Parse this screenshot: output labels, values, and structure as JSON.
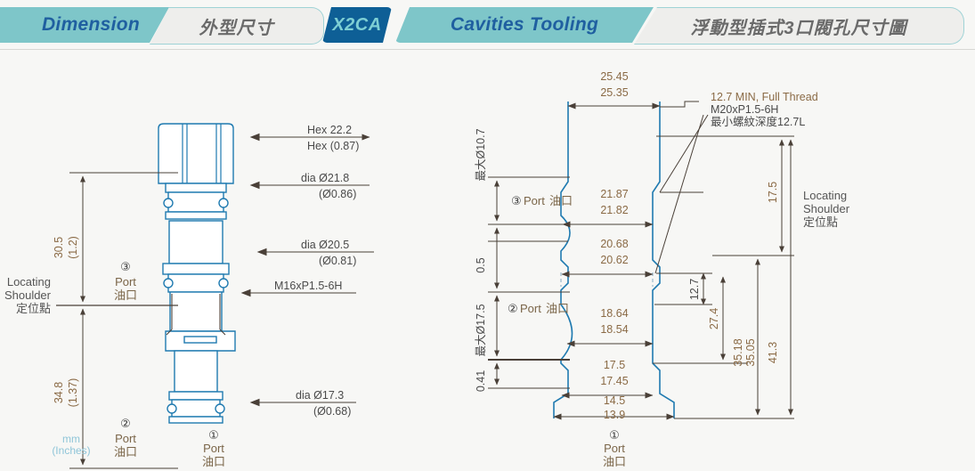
{
  "header": {
    "tabs": [
      {
        "id": "dimension",
        "label": "Dimension",
        "type": "en"
      },
      {
        "id": "dimension-zh",
        "label": "外型尺寸",
        "type": "zh"
      },
      {
        "id": "x2ca",
        "label": "X2CA",
        "type": "code"
      },
      {
        "id": "cavities-tooling",
        "label": "Cavities Tooling",
        "type": "en"
      },
      {
        "id": "cavities-tooling-zh",
        "label": "浮動型插式3口閥孔尺寸圖",
        "type": "zh"
      }
    ],
    "colors": {
      "teal": "#7ec6c9",
      "dark_blue": "#0e5f96",
      "light_gray": "#eeeeec",
      "text_blue": "#1f5fa0",
      "badge_text": "#7ecfd4"
    }
  },
  "left_drawing": {
    "title_unit_mm": "mm",
    "title_unit_in": "(Inches)",
    "vertical_dims": [
      {
        "id": "upper",
        "mm": "30.5",
        "inch": "(1.2)"
      },
      {
        "id": "lower",
        "mm": "34.8",
        "inch": "(1.37)"
      }
    ],
    "locating_shoulder": {
      "line1": "Locating",
      "line2": "Shoulder",
      "line3": "定位點"
    },
    "port_callouts": [
      {
        "num": "③",
        "en": "Port",
        "zh": "油口"
      },
      {
        "num": "②",
        "en": "Port",
        "zh": "油口"
      },
      {
        "num": "①",
        "en": "Port",
        "zh": "油口"
      }
    ],
    "leader_labels": [
      {
        "id": "hex",
        "top": "Hex  22.2",
        "bottom": "Hex  (0.87)"
      },
      {
        "id": "dia-21-8",
        "top": "dia  Ø21.8",
        "bottom": "(Ø0.86)"
      },
      {
        "id": "dia-20-5",
        "top": "dia  Ø20.5",
        "bottom": "(Ø0.81)"
      },
      {
        "id": "thread",
        "top": "M16xP1.5-6H",
        "bottom": ""
      },
      {
        "id": "dia-17-3",
        "top": "dia  Ø17.3",
        "bottom": "(Ø0.68)"
      }
    ]
  },
  "right_drawing": {
    "top_dim": {
      "upper": "25.45",
      "lower": "25.35"
    },
    "bore_dims": [
      {
        "id": "d2187",
        "upper": "21.87",
        "lower": "21.82"
      },
      {
        "id": "d2068",
        "upper": "20.68",
        "lower": "20.62"
      },
      {
        "id": "d1864",
        "upper": "18.64",
        "lower": "18.54"
      },
      {
        "id": "d175",
        "upper": "17.5",
        "lower": "17.45"
      },
      {
        "id": "d145",
        "upper": "14.5",
        "lower": "13.9"
      }
    ],
    "left_vertical_labels": [
      {
        "id": "max107",
        "text": "最大Ø10.7"
      },
      {
        "id": "gap05",
        "text": "0.5"
      },
      {
        "id": "max175",
        "text": "最大Ø17.5"
      },
      {
        "id": "gap041",
        "text": "0.41"
      }
    ],
    "left_port_callouts": [
      {
        "num": "③",
        "en": "Port",
        "zh": "油口"
      },
      {
        "num": "②",
        "en": "Port",
        "zh": "油口"
      }
    ],
    "bottom_port": {
      "num": "①",
      "en": "Port",
      "zh": "油口"
    },
    "thread_note": {
      "line1": "12.7 MIN, Full Thread",
      "line2": "M20xP1.5-6H",
      "line3": "最小螺紋深度12.7L"
    },
    "right_vertical_dims": [
      {
        "id": "v127",
        "text": "12.7"
      },
      {
        "id": "v274",
        "text": "27.4"
      },
      {
        "id": "v3518",
        "text": "35.18"
      },
      {
        "id": "v3505",
        "text": "35.05"
      },
      {
        "id": "v413",
        "text": "41.3"
      },
      {
        "id": "v175",
        "text": "17.5"
      }
    ],
    "locating_shoulder": {
      "line1": "Locating",
      "line2": "Shoulder",
      "line3": "定位點"
    }
  },
  "colors": {
    "part_outline": "#1f7ab0",
    "dim_line": "#4a4038",
    "dim_text": "#8a6a45",
    "background": "#f7f7f5"
  }
}
